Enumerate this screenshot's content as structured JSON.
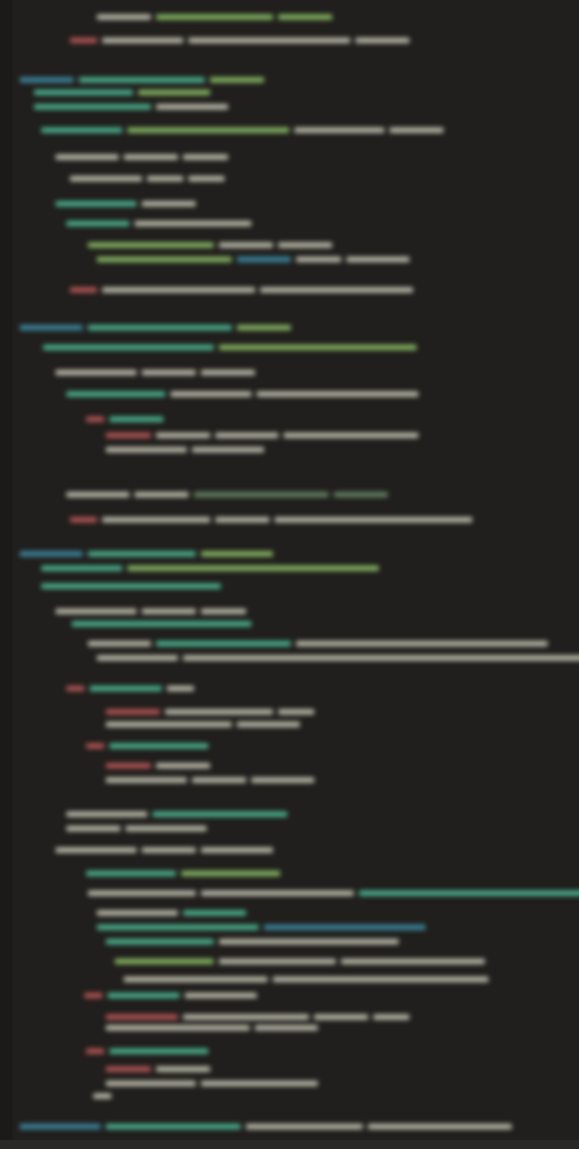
{
  "editor": {
    "palette": {
      "background": "#211f1d",
      "text": "#c9c9b8",
      "tag": "#3f8fa8",
      "attribute": "#4fbf9a",
      "string": "#8fc46a",
      "keyword": "#c05a5a",
      "comment": "#6a8a6a"
    }
  }
}
